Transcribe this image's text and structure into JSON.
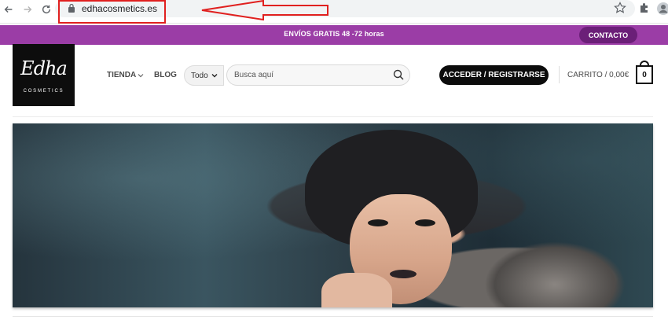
{
  "browser": {
    "url": "edhacosmetics.es"
  },
  "promo_bar": {
    "text": "ENVÍOS GRATIS 48 -72 horas",
    "contact_label": "CONTACTO",
    "bg_color": "#9b3da6",
    "button_color": "#6b1f78"
  },
  "header": {
    "logo": {
      "script": "Edha",
      "subtitle": "COSMETICS"
    },
    "nav": {
      "tienda_label": "TIENDA",
      "blog_label": "BLOG"
    },
    "search": {
      "category_value": "Todo",
      "placeholder": "Busca aquí"
    },
    "login_label": "ACCEDER / REGISTRARSE",
    "cart_label": "CARRITO / 0,00€",
    "cart_count": "0"
  },
  "hero": {
    "image": "woman-in-fur-hood-portrait"
  },
  "annotations": {
    "highlight_color": "#e0201f"
  }
}
